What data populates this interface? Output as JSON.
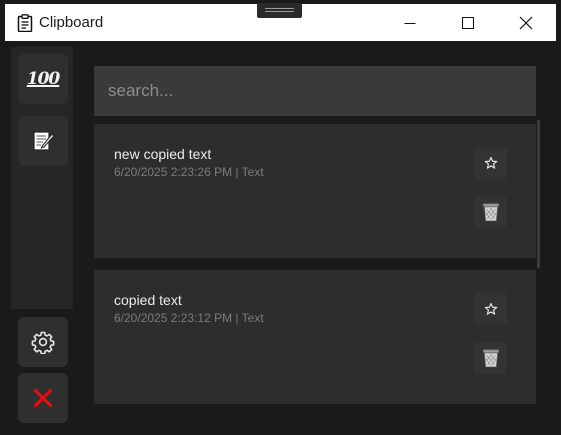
{
  "window": {
    "title": "Clipboard",
    "controls": [
      "minimize",
      "maximize",
      "close"
    ]
  },
  "sidebar": {
    "top_buttons": [
      {
        "name": "hundred-points",
        "icon": "hundred-points-icon",
        "glyph": "100"
      },
      {
        "name": "notes",
        "icon": "memo-pencil-icon"
      }
    ],
    "bottom_buttons": [
      {
        "name": "settings",
        "icon": "gear-icon"
      },
      {
        "name": "exit",
        "icon": "red-x-icon",
        "color": "#e01010"
      }
    ]
  },
  "search": {
    "value": "",
    "placeholder": "search..."
  },
  "items": [
    {
      "text": "new copied text",
      "meta": "6/20/2025 2:23:26 PM | Text",
      "starred": false
    },
    {
      "text": "copied text",
      "meta": "6/20/2025 2:23:12 PM | Text",
      "starred": false
    }
  ],
  "colors": {
    "background": "#1a1a1a",
    "card": "#2d2d2d",
    "search_bg": "#3a3a3a",
    "accent_red": "#e01010"
  }
}
